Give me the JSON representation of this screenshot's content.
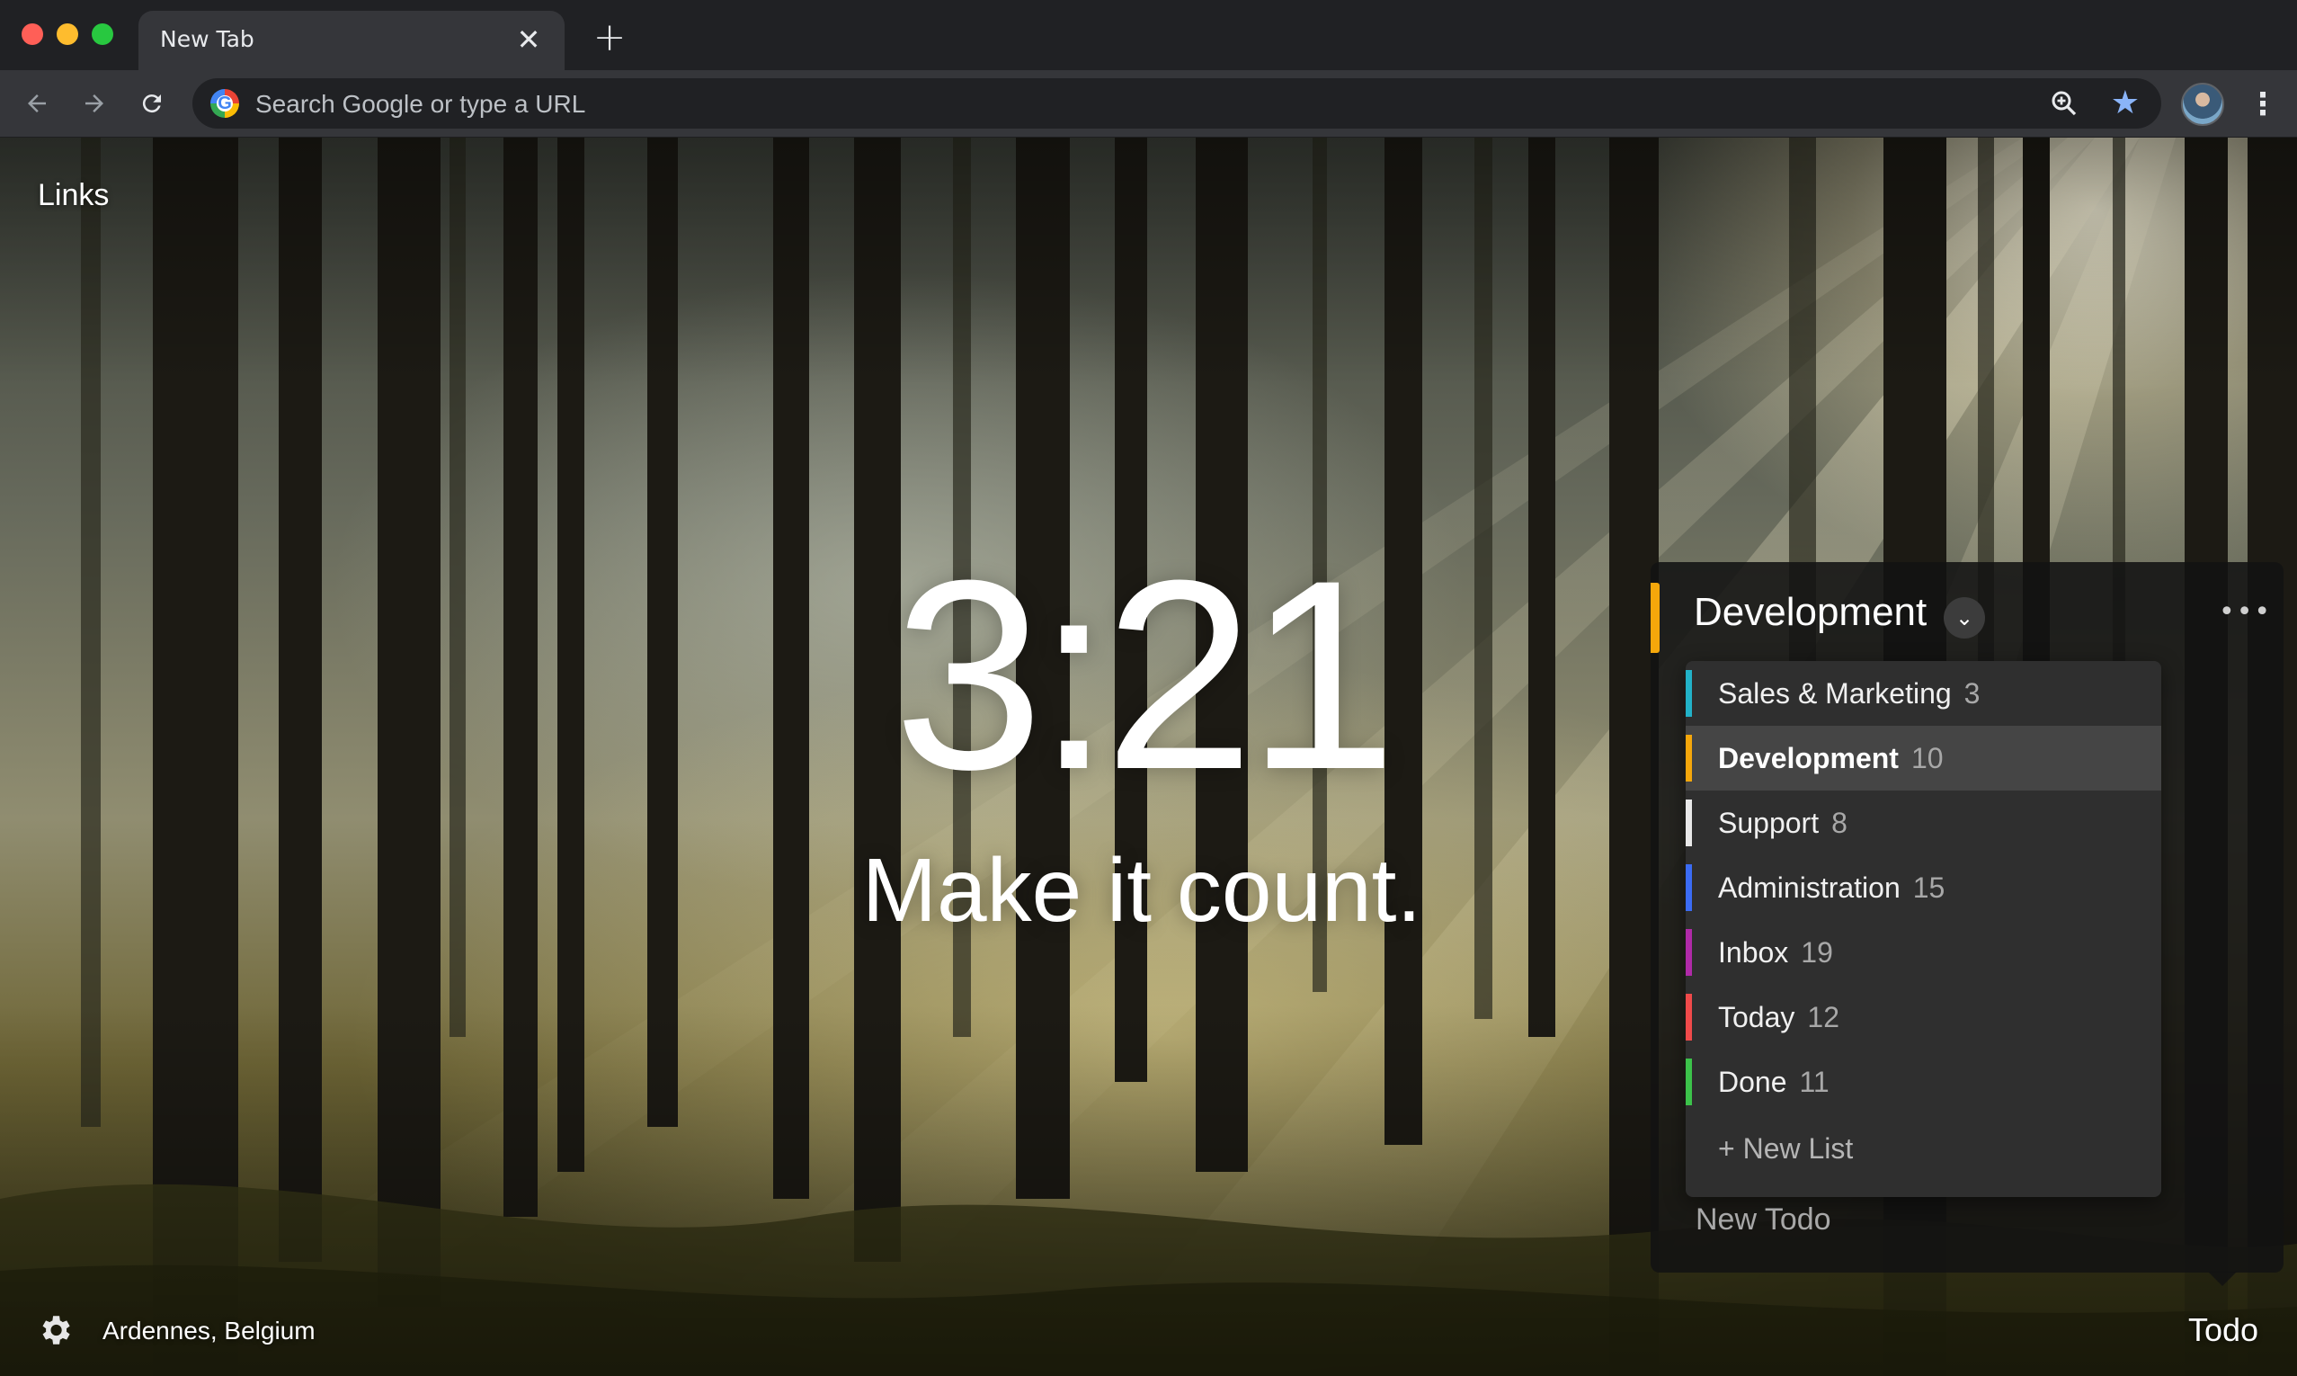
{
  "browser": {
    "tab": {
      "title": "New Tab",
      "close_symbol": "✕"
    },
    "new_tab_symbol": "+",
    "omnibox": {
      "placeholder": "Search Google or type a URL",
      "value": ""
    },
    "icons": {
      "back": "arrow-left-icon",
      "forward": "arrow-right-icon",
      "reload": "reload-icon",
      "zoom": "zoom-in-icon",
      "bookmark": "star-icon",
      "menu": "kebab-menu-icon"
    }
  },
  "dashboard": {
    "links_label": "Links",
    "clock": "3:21",
    "mantra": "Make it count.",
    "location": "Ardennes, Belgium",
    "todo_label": "Todo"
  },
  "todo": {
    "current_list": "Development",
    "accent_color": "#f5a70b",
    "more_symbol": "•••",
    "lists": [
      {
        "name": "Sales & Marketing",
        "count": "3",
        "color": "#22b2c8",
        "active": false
      },
      {
        "name": "Development",
        "count": "10",
        "color": "#f5a70b",
        "active": true
      },
      {
        "name": "Support",
        "count": "8",
        "color": "#e8e8e8",
        "active": false
      },
      {
        "name": "Administration",
        "count": "15",
        "color": "#3b6cf4",
        "active": false
      },
      {
        "name": "Inbox",
        "count": "19",
        "color": "#b02aa8",
        "active": false
      },
      {
        "name": "Today",
        "count": "12",
        "color": "#f04a4a",
        "active": false
      },
      {
        "name": "Done",
        "count": "11",
        "color": "#3cc24a",
        "active": false
      }
    ],
    "new_list_label": "+ New List",
    "new_todo_placeholder": "New Todo"
  }
}
